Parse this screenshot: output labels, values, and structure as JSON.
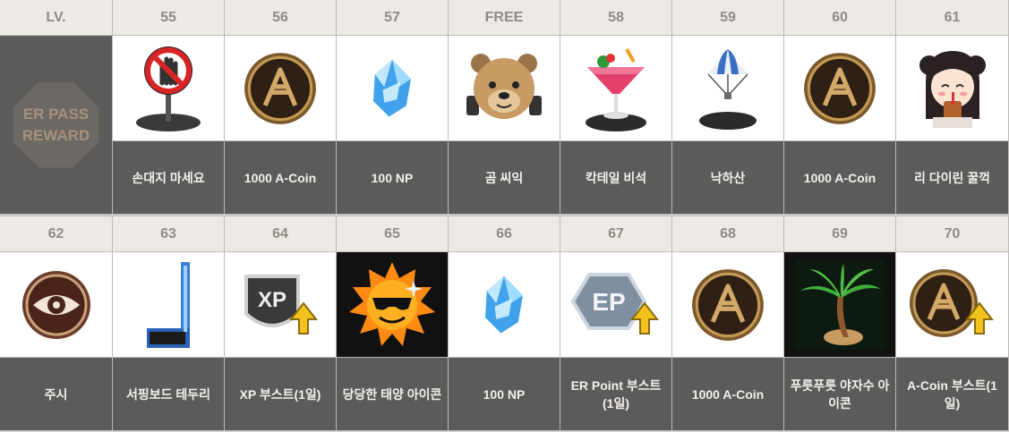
{
  "rows": [
    {
      "header_label": "LV.",
      "side_label_line1": "ER PASS",
      "side_label_line2": "REWARD",
      "levels": [
        "55",
        "56",
        "57",
        "FREE",
        "58",
        "59",
        "60",
        "61"
      ],
      "items": [
        {
          "name": "손대지 마세요",
          "icon": "no-touching-sign-icon"
        },
        {
          "name": "1000 A-Coin",
          "icon": "a-coin-icon"
        },
        {
          "name": "100 NP",
          "icon": "np-crystal-icon"
        },
        {
          "name": "곰 씨익",
          "icon": "grinning-bear-icon"
        },
        {
          "name": "칵테일 비석",
          "icon": "cocktail-tombstone-icon"
        },
        {
          "name": "낙하산",
          "icon": "parachute-icon"
        },
        {
          "name": "1000 A-Coin",
          "icon": "a-coin-icon"
        },
        {
          "name": "리 다이린 꿀꺽",
          "icon": "li-dailin-gulp-icon"
        }
      ]
    },
    {
      "levels": [
        "62",
        "63",
        "64",
        "65",
        "66",
        "67",
        "68",
        "69",
        "70"
      ],
      "items": [
        {
          "name": "주시",
          "icon": "watching-eye-icon"
        },
        {
          "name": "서핑보드 테두리",
          "icon": "surfboard-frame-icon"
        },
        {
          "name": "XP 부스트(1일)",
          "icon": "xp-boost-icon"
        },
        {
          "name": "당당한 태양 아이콘",
          "icon": "confident-sun-icon"
        },
        {
          "name": "100 NP",
          "icon": "np-crystal-icon"
        },
        {
          "name": "ER Point 부스트(1일)",
          "icon": "er-point-boost-icon"
        },
        {
          "name": "1000 A-Coin",
          "icon": "a-coin-icon"
        },
        {
          "name": "푸릇푸릇 야자수 아이콘",
          "icon": "palm-tree-icon"
        },
        {
          "name": "A-Coin 부스트(1일)",
          "icon": "a-coin-boost-icon"
        }
      ]
    }
  ],
  "colors": {
    "header_bg": "#ede9e5",
    "label_bg": "#5b5b5b",
    "accent_gold": "#a7917c"
  }
}
